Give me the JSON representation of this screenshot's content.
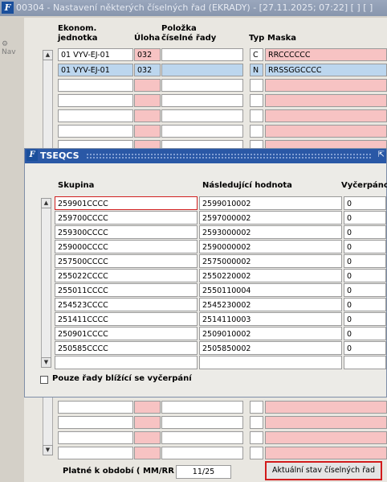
{
  "window": {
    "title": "00304 - Nastavení některých číselných řad (EKRADY) - [27.11.2025; 07:22]  [ ]  [ ]",
    "logo": "F"
  },
  "nav": {
    "label": "Nav"
  },
  "columns": {
    "ekonom": "Ekonom.",
    "jednotka": "jednotka",
    "uloha": "Úloha",
    "polozka": "Položka",
    "ciselne": "číselné řady",
    "typ": "Typ",
    "maska": "Maska"
  },
  "rows": [
    {
      "ekonom": "01 VYV-EJ-01",
      "uloha": "032",
      "polozka": "",
      "typ": "C",
      "maska": "RRCCCCCC"
    },
    {
      "ekonom": "01 VYV-EJ-01",
      "uloha": "032",
      "polozka": "",
      "typ": "N",
      "maska": "RRSSGGCCCC"
    }
  ],
  "dialog": {
    "title": "TSEQCS",
    "columns": {
      "skupina": "Skupina",
      "nasledujici": "Následující hodnota",
      "vycerpano": "Vyčerpáno"
    },
    "rows": [
      {
        "skupina": "259901CCCC",
        "nasledujici": "2599010002",
        "vycerpano": "0"
      },
      {
        "skupina": "259700CCCC",
        "nasledujici": "2597000002",
        "vycerpano": "0"
      },
      {
        "skupina": "259300CCCC",
        "nasledujici": "2593000002",
        "vycerpano": "0"
      },
      {
        "skupina": "259000CCCC",
        "nasledujici": "2590000002",
        "vycerpano": "0"
      },
      {
        "skupina": "257500CCCC",
        "nasledujici": "2575000002",
        "vycerpano": "0"
      },
      {
        "skupina": "255022CCCC",
        "nasledujici": "2550220002",
        "vycerpano": "0"
      },
      {
        "skupina": "255011CCCC",
        "nasledujici": "2550110004",
        "vycerpano": "0"
      },
      {
        "skupina": "254523CCCC",
        "nasledujici": "2545230002",
        "vycerpano": "0"
      },
      {
        "skupina": "251411CCCC",
        "nasledujici": "2514110003",
        "vycerpano": "0"
      },
      {
        "skupina": "250901CCCC",
        "nasledujici": "2509010002",
        "vycerpano": "0"
      },
      {
        "skupina": "250585CCCC",
        "nasledujici": "2505850002",
        "vycerpano": "0"
      }
    ],
    "checkbox_label": "Pouze řady blížící se vyčerpání"
  },
  "footer": {
    "period_label": "Platné k období ( MM/RR )",
    "period_value": "11/25",
    "status_button": "Aktuální stav číselných řad"
  },
  "colors": {
    "title_bar": "#2a58a6",
    "highlight": "#d21b1b",
    "pink_field": "#f7c3c3",
    "selected_row": "#bcd6ee"
  }
}
